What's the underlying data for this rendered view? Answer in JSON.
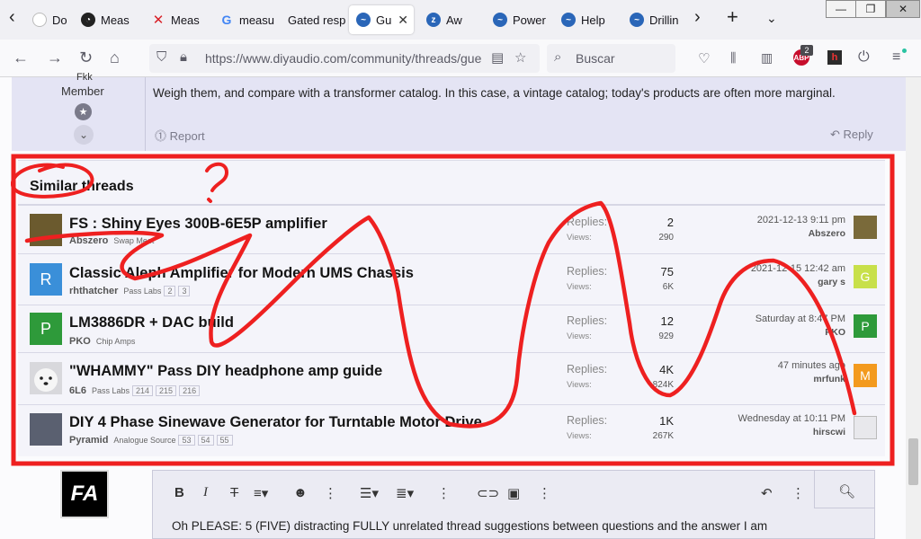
{
  "browser": {
    "tabs": [
      {
        "title": "Down",
        "icon": "download-icon",
        "color": "#ffffff"
      },
      {
        "title": "Meas",
        "icon": "measure-app-icon",
        "color": "#222222"
      },
      {
        "title": "Meas",
        "icon": "x-logo-icon",
        "color": "#d81f26"
      },
      {
        "title": "measu",
        "icon": "google-icon",
        "color": "#4285f4"
      },
      {
        "title": "Gated resp",
        "icon": "blank-page-icon",
        "color": "#ffffff"
      },
      {
        "title": "Gu",
        "icon": "diyaudio-icon",
        "color": "#2a66b8"
      },
      {
        "title": "Aw",
        "icon": "diyaudio-sleeping-icon",
        "color": "#2a66b8"
      },
      {
        "title": "Power",
        "icon": "diyaudio-icon",
        "color": "#2a66b8"
      },
      {
        "title": "Help",
        "icon": "diyaudio-icon",
        "color": "#2a66b8"
      },
      {
        "title": "Drillin",
        "icon": "diyaudio-icon",
        "color": "#2a66b8"
      }
    ],
    "active_tab_index": 5,
    "url": "https://www.diyaudio.com/community/threads/gue",
    "search_placeholder": "Buscar",
    "abp_badge": "2",
    "abp_label": "ABP"
  },
  "post": {
    "user_fragment": "Fkk",
    "role": "Member",
    "text": "Weigh them, and compare with a transformer catalog. In this case, a vintage catalog; today's products are often more marginal.",
    "report_label": "Report",
    "reply_label": "Reply"
  },
  "similar": {
    "title": "Similar threads",
    "replies_label": "Replies:",
    "views_label": "Views:",
    "threads": [
      {
        "title": "FS : Shiny Eyes 300B-6E5P amplifier",
        "author": "Abszero",
        "forum": "Swap Meet",
        "pages": [],
        "replies": "2",
        "views": "290",
        "last_date": "2021-12-13 9:11 pm",
        "last_user": "Abszero",
        "avatar_color": "#6b5a2e",
        "avatar_letter": "",
        "ravatar_color": "#7a6a3a",
        "ravatar_letter": ""
      },
      {
        "title": "Classic Aleph Amplifier for Modern UMS Chassis",
        "author": "rhthatcher",
        "forum": "Pass Labs",
        "pages": [
          "2",
          "3"
        ],
        "replies": "75",
        "views": "6K",
        "last_date": "2021-12-15 12:42 am",
        "last_user": "gary s",
        "avatar_color": "#3a8fd9",
        "avatar_letter": "R",
        "ravatar_color": "#c8e04a",
        "ravatar_letter": "G"
      },
      {
        "title": "LM3886DR + DAC build",
        "author": "PKO",
        "forum": "Chip Amps",
        "pages": [],
        "replies": "12",
        "views": "929",
        "last_date": "Saturday at 8:47 PM",
        "last_user": "PKO",
        "avatar_color": "#2e9a3a",
        "avatar_letter": "P",
        "ravatar_color": "#2e9a3a",
        "ravatar_letter": "P"
      },
      {
        "title": "\"WHAMMY\" Pass DIY headphone amp guide",
        "author": "6L6",
        "forum": "Pass Labs",
        "pages": [
          "214",
          "215",
          "216"
        ],
        "replies": "4K",
        "views": "824K",
        "last_date": "47 minutes ago",
        "last_user": "mrfunk",
        "avatar_color": "#d8d8dc",
        "avatar_letter": "",
        "ravatar_color": "#f39a1e",
        "ravatar_letter": "M"
      },
      {
        "title": "DIY 4 Phase Sinewave Generator for Turntable Motor Drive",
        "author": "Pyramid",
        "forum": "Analogue Source",
        "pages": [
          "53",
          "54",
          "55"
        ],
        "replies": "1K",
        "views": "267K",
        "last_date": "Wednesday at 10:11 PM",
        "last_user": "hirscwi",
        "avatar_color": "#5a6070",
        "avatar_letter": "",
        "ravatar_color": "#e8e8ec",
        "ravatar_letter": ""
      }
    ]
  },
  "editor": {
    "avatar_text": "FA",
    "tools": [
      "bold-icon",
      "italic-icon",
      "strikethrough-icon",
      "text-style-icon",
      "emoji-icon",
      "more-icon",
      "list-icon",
      "align-icon",
      "more-icon",
      "link-icon",
      "image-icon",
      "more-icon",
      "undo-icon",
      "more-icon",
      "preview-icon"
    ],
    "text": "Oh PLEASE: 5 (FIVE) distracting FULLY unrelated thread suggestions between questions and the answer I am"
  },
  "annotation": {
    "color": "#ee2020",
    "shape": "red-rectangle-and-scribble"
  }
}
